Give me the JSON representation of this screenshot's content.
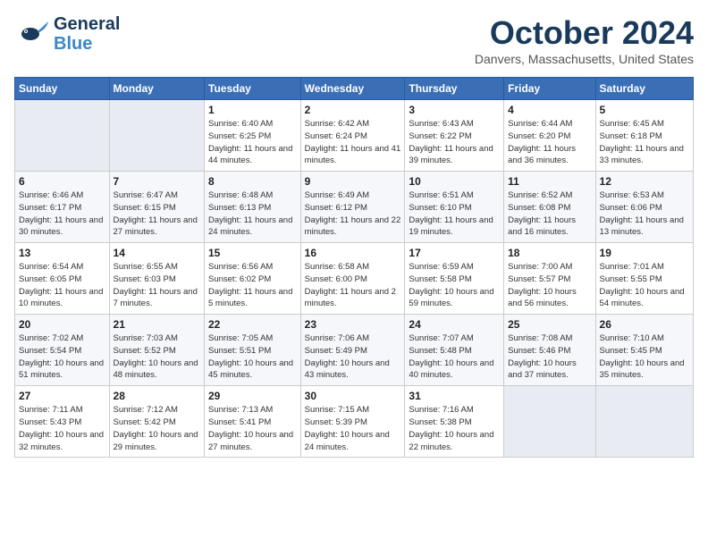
{
  "header": {
    "logo_line1": "General",
    "logo_line2": "Blue",
    "month": "October 2024",
    "location": "Danvers, Massachusetts, United States"
  },
  "days_of_week": [
    "Sunday",
    "Monday",
    "Tuesday",
    "Wednesday",
    "Thursday",
    "Friday",
    "Saturday"
  ],
  "weeks": [
    [
      {
        "day": "",
        "sunrise": "",
        "sunset": "",
        "daylight": ""
      },
      {
        "day": "",
        "sunrise": "",
        "sunset": "",
        "daylight": ""
      },
      {
        "day": "1",
        "sunrise": "Sunrise: 6:40 AM",
        "sunset": "Sunset: 6:25 PM",
        "daylight": "Daylight: 11 hours and 44 minutes."
      },
      {
        "day": "2",
        "sunrise": "Sunrise: 6:42 AM",
        "sunset": "Sunset: 6:24 PM",
        "daylight": "Daylight: 11 hours and 41 minutes."
      },
      {
        "day": "3",
        "sunrise": "Sunrise: 6:43 AM",
        "sunset": "Sunset: 6:22 PM",
        "daylight": "Daylight: 11 hours and 39 minutes."
      },
      {
        "day": "4",
        "sunrise": "Sunrise: 6:44 AM",
        "sunset": "Sunset: 6:20 PM",
        "daylight": "Daylight: 11 hours and 36 minutes."
      },
      {
        "day": "5",
        "sunrise": "Sunrise: 6:45 AM",
        "sunset": "Sunset: 6:18 PM",
        "daylight": "Daylight: 11 hours and 33 minutes."
      }
    ],
    [
      {
        "day": "6",
        "sunrise": "Sunrise: 6:46 AM",
        "sunset": "Sunset: 6:17 PM",
        "daylight": "Daylight: 11 hours and 30 minutes."
      },
      {
        "day": "7",
        "sunrise": "Sunrise: 6:47 AM",
        "sunset": "Sunset: 6:15 PM",
        "daylight": "Daylight: 11 hours and 27 minutes."
      },
      {
        "day": "8",
        "sunrise": "Sunrise: 6:48 AM",
        "sunset": "Sunset: 6:13 PM",
        "daylight": "Daylight: 11 hours and 24 minutes."
      },
      {
        "day": "9",
        "sunrise": "Sunrise: 6:49 AM",
        "sunset": "Sunset: 6:12 PM",
        "daylight": "Daylight: 11 hours and 22 minutes."
      },
      {
        "day": "10",
        "sunrise": "Sunrise: 6:51 AM",
        "sunset": "Sunset: 6:10 PM",
        "daylight": "Daylight: 11 hours and 19 minutes."
      },
      {
        "day": "11",
        "sunrise": "Sunrise: 6:52 AM",
        "sunset": "Sunset: 6:08 PM",
        "daylight": "Daylight: 11 hours and 16 minutes."
      },
      {
        "day": "12",
        "sunrise": "Sunrise: 6:53 AM",
        "sunset": "Sunset: 6:06 PM",
        "daylight": "Daylight: 11 hours and 13 minutes."
      }
    ],
    [
      {
        "day": "13",
        "sunrise": "Sunrise: 6:54 AM",
        "sunset": "Sunset: 6:05 PM",
        "daylight": "Daylight: 11 hours and 10 minutes."
      },
      {
        "day": "14",
        "sunrise": "Sunrise: 6:55 AM",
        "sunset": "Sunset: 6:03 PM",
        "daylight": "Daylight: 11 hours and 7 minutes."
      },
      {
        "day": "15",
        "sunrise": "Sunrise: 6:56 AM",
        "sunset": "Sunset: 6:02 PM",
        "daylight": "Daylight: 11 hours and 5 minutes."
      },
      {
        "day": "16",
        "sunrise": "Sunrise: 6:58 AM",
        "sunset": "Sunset: 6:00 PM",
        "daylight": "Daylight: 11 hours and 2 minutes."
      },
      {
        "day": "17",
        "sunrise": "Sunrise: 6:59 AM",
        "sunset": "Sunset: 5:58 PM",
        "daylight": "Daylight: 10 hours and 59 minutes."
      },
      {
        "day": "18",
        "sunrise": "Sunrise: 7:00 AM",
        "sunset": "Sunset: 5:57 PM",
        "daylight": "Daylight: 10 hours and 56 minutes."
      },
      {
        "day": "19",
        "sunrise": "Sunrise: 7:01 AM",
        "sunset": "Sunset: 5:55 PM",
        "daylight": "Daylight: 10 hours and 54 minutes."
      }
    ],
    [
      {
        "day": "20",
        "sunrise": "Sunrise: 7:02 AM",
        "sunset": "Sunset: 5:54 PM",
        "daylight": "Daylight: 10 hours and 51 minutes."
      },
      {
        "day": "21",
        "sunrise": "Sunrise: 7:03 AM",
        "sunset": "Sunset: 5:52 PM",
        "daylight": "Daylight: 10 hours and 48 minutes."
      },
      {
        "day": "22",
        "sunrise": "Sunrise: 7:05 AM",
        "sunset": "Sunset: 5:51 PM",
        "daylight": "Daylight: 10 hours and 45 minutes."
      },
      {
        "day": "23",
        "sunrise": "Sunrise: 7:06 AM",
        "sunset": "Sunset: 5:49 PM",
        "daylight": "Daylight: 10 hours and 43 minutes."
      },
      {
        "day": "24",
        "sunrise": "Sunrise: 7:07 AM",
        "sunset": "Sunset: 5:48 PM",
        "daylight": "Daylight: 10 hours and 40 minutes."
      },
      {
        "day": "25",
        "sunrise": "Sunrise: 7:08 AM",
        "sunset": "Sunset: 5:46 PM",
        "daylight": "Daylight: 10 hours and 37 minutes."
      },
      {
        "day": "26",
        "sunrise": "Sunrise: 7:10 AM",
        "sunset": "Sunset: 5:45 PM",
        "daylight": "Daylight: 10 hours and 35 minutes."
      }
    ],
    [
      {
        "day": "27",
        "sunrise": "Sunrise: 7:11 AM",
        "sunset": "Sunset: 5:43 PM",
        "daylight": "Daylight: 10 hours and 32 minutes."
      },
      {
        "day": "28",
        "sunrise": "Sunrise: 7:12 AM",
        "sunset": "Sunset: 5:42 PM",
        "daylight": "Daylight: 10 hours and 29 minutes."
      },
      {
        "day": "29",
        "sunrise": "Sunrise: 7:13 AM",
        "sunset": "Sunset: 5:41 PM",
        "daylight": "Daylight: 10 hours and 27 minutes."
      },
      {
        "day": "30",
        "sunrise": "Sunrise: 7:15 AM",
        "sunset": "Sunset: 5:39 PM",
        "daylight": "Daylight: 10 hours and 24 minutes."
      },
      {
        "day": "31",
        "sunrise": "Sunrise: 7:16 AM",
        "sunset": "Sunset: 5:38 PM",
        "daylight": "Daylight: 10 hours and 22 minutes."
      },
      {
        "day": "",
        "sunrise": "",
        "sunset": "",
        "daylight": ""
      },
      {
        "day": "",
        "sunrise": "",
        "sunset": "",
        "daylight": ""
      }
    ]
  ]
}
